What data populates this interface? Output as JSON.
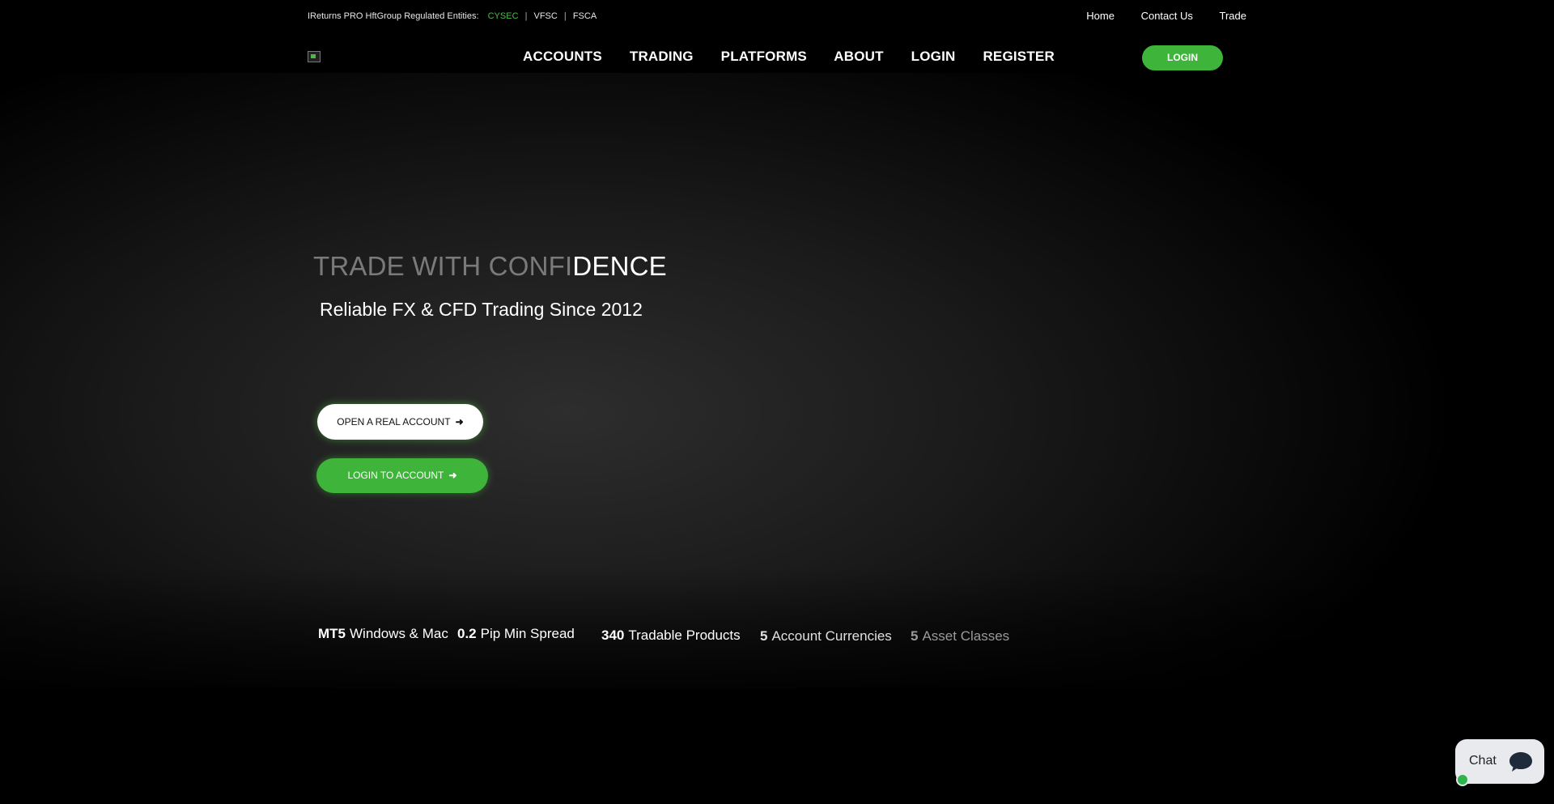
{
  "topbar": {
    "entities_label": "IReturns PRO HftGroup Regulated Entities:",
    "regulators": [
      "CYSEC",
      "VFSC",
      "FSCA"
    ],
    "separator": "|",
    "links": [
      "Home",
      "Contact Us",
      "Trade"
    ]
  },
  "nav": {
    "items": [
      "ACCOUNTS",
      "TRADING",
      "PLATFORMS",
      "ABOUT",
      "LOGIN",
      "REGISTER"
    ],
    "login_button": "LOGIN"
  },
  "hero": {
    "headline_dim": "TRADE WITH CONFI",
    "headline_bright": "DENCE",
    "subline": "Reliable FX & CFD Trading Since 2012",
    "btn_real": "OPEN A REAL ACCOUNT",
    "btn_login": "LOGIN TO ACCOUNT",
    "arrow_glyph": "➜"
  },
  "stats": [
    {
      "value": "MT5",
      "label": "Windows & Mac"
    },
    {
      "value": "0.2",
      "label": "Pip Min Spread"
    },
    {
      "value": "340",
      "label": "Tradable Products"
    },
    {
      "value": "5",
      "label": "Account Currencies"
    },
    {
      "value": "5",
      "label": "Asset Classes"
    }
  ],
  "chat": {
    "label": "Chat",
    "icon": "chat-bubble-icon"
  },
  "colors": {
    "accent": "#3fb43b",
    "background": "#000000"
  }
}
